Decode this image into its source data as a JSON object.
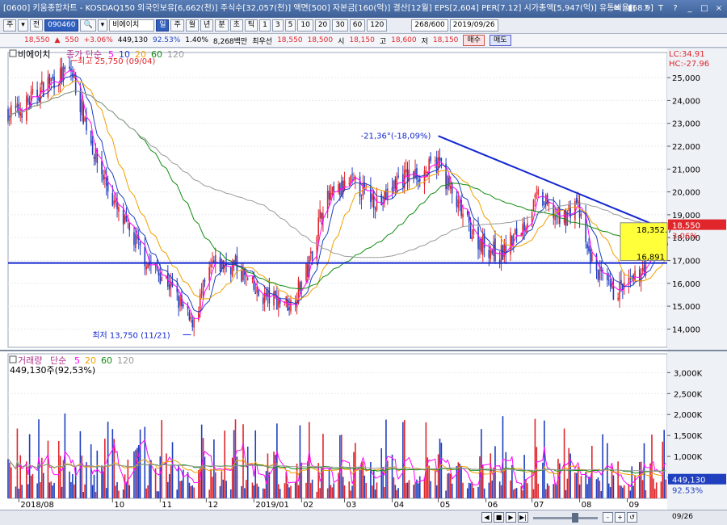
{
  "window": {
    "title": "[0600] 키움종합차트 - KOSDAQ150 외국인보유[6,662(천)] 주식수[32,057(천)] 액면[500] 자본금[160(억)] 결산[12월] EPS[2,604] PER[7.12] 시가총액[5,947(억)] 유통비율[68.9]",
    "controls": [
      "✉",
      "◧",
      "?",
      "T",
      "?",
      "_",
      "□",
      "×"
    ]
  },
  "toolbar": {
    "items": [
      "주",
      "▾",
      "전",
      "090460",
      "🔍",
      "▾",
      "비에이치"
    ],
    "period_buttons": [
      "일",
      "주",
      "월",
      "년",
      "분",
      "초",
      "틱"
    ],
    "interval_buttons": [
      "1",
      "3",
      "5",
      "10",
      "20",
      "30",
      "60",
      "120"
    ],
    "count": "268",
    "count_total": "/600",
    "date": "2019/09/26"
  },
  "quote": {
    "price": "18,550",
    "arrow": "▲",
    "change": "550",
    "change_pct": "+3.06%",
    "volume": "449,130",
    "vol_ratio": "92.53%",
    "turnover": "1.40%",
    "amount": "8,268백만",
    "best_ask_label": "최우선",
    "best_ask": "18,550",
    "best_bid": "18,500",
    "open_label": "시",
    "open": "18,150",
    "high_label": "고",
    "high": "18,600",
    "low_label": "저",
    "low": "18,150",
    "buy_label": "매수",
    "sell_label": "매도"
  },
  "price_panel": {
    "stock_name": "비에이치",
    "legend_prefix": "종가 단순",
    "ma": [
      "5",
      "10",
      "20",
      "60",
      "120"
    ],
    "ma_colors": [
      "#ff00ff",
      "#1f3fbf",
      "#f0a000",
      "#108c10",
      "#9a9a9a"
    ],
    "high_marker": "최고 25,750 (09/04)",
    "low_marker": "최저 13,750 (11/21)",
    "trend_label": "-21,36°(-18,09%)",
    "lc": "LC:34.91",
    "hc": "HC:-27.96",
    "price_box_label": "18,550",
    "pct_box_label": "3.06%",
    "trend_price": "18,352.7",
    "support_price": "16,891"
  },
  "volume_panel": {
    "title": "거래량",
    "legend_prefix": "단순",
    "ma": [
      "5",
      "20",
      "60",
      "120"
    ],
    "ma_colors": [
      "#ff00ff",
      "#f0a000",
      "#108c10",
      "#9a9a9a"
    ],
    "value_line": "449,130주(92,53%)",
    "vol_box": "449,130",
    "vol_pct": "92.53%"
  },
  "x_axis": {
    "labels": [
      "2018/08",
      "10",
      "11",
      "12",
      "2019/01",
      "02",
      "03",
      "04",
      "05",
      "06",
      "07",
      "08",
      "09"
    ],
    "end_label": "09/26"
  },
  "colors": {
    "up": "#e0262b",
    "down": "#1f3fbf",
    "trendline": "#1428d0",
    "highlight": "#ffff3a"
  },
  "chart_data": {
    "type": "candlestick",
    "price_axis": {
      "ticks": [
        14000,
        15000,
        16000,
        17000,
        18000,
        19000,
        20000,
        21000,
        22000,
        23000,
        24000,
        25000
      ],
      "range": [
        13200,
        26100
      ]
    },
    "volume_axis": {
      "ticks": [
        500000,
        1000000,
        1500000,
        2000000,
        2500000,
        3000000
      ],
      "tick_labels": [
        "500K",
        "1,000K",
        "1,500K",
        "2,000K",
        "2,500K",
        "3,000K"
      ],
      "range": [
        0,
        3450000
      ]
    },
    "ohlc_anchors": [
      [
        "2018/08/01",
        23500
      ],
      [
        "2018/08/20",
        24800
      ],
      [
        "2018/09/04",
        25300
      ],
      [
        "2018/09/20",
        21500
      ],
      [
        "2018/10/05",
        19000
      ],
      [
        "2018/10/25",
        16800
      ],
      [
        "2018/11/05",
        16200
      ],
      [
        "2018/11/21",
        14200
      ],
      [
        "2018/12/05",
        16800
      ],
      [
        "2018/12/20",
        16800
      ],
      [
        "2019/01/03",
        15500
      ],
      [
        "2019/01/25",
        15100
      ],
      [
        "2019/02/05",
        16600
      ],
      [
        "2019/02/15",
        19500
      ],
      [
        "2019/03/05",
        20400
      ],
      [
        "2019/03/25",
        19500
      ],
      [
        "2019/04/05",
        20600
      ],
      [
        "2019/04/20",
        20800
      ],
      [
        "2019/05/02",
        21300
      ],
      [
        "2019/05/10",
        19800
      ],
      [
        "2019/05/25",
        18000
      ],
      [
        "2019/06/10",
        17200
      ],
      [
        "2019/06/25",
        18500
      ],
      [
        "2019/07/05",
        19800
      ],
      [
        "2019/07/20",
        18700
      ],
      [
        "2019/07/30",
        19600
      ],
      [
        "2019/08/06",
        17400
      ],
      [
        "2019/08/15",
        16200
      ],
      [
        "2019/08/22",
        15600
      ],
      [
        "2019/09/05",
        16000
      ],
      [
        "2019/09/26",
        18550
      ]
    ],
    "trendline": {
      "from": [
        "2019/05/01",
        22450
      ],
      "to": [
        "2019/09/26",
        18352.7
      ]
    },
    "support_line": 16891
  }
}
